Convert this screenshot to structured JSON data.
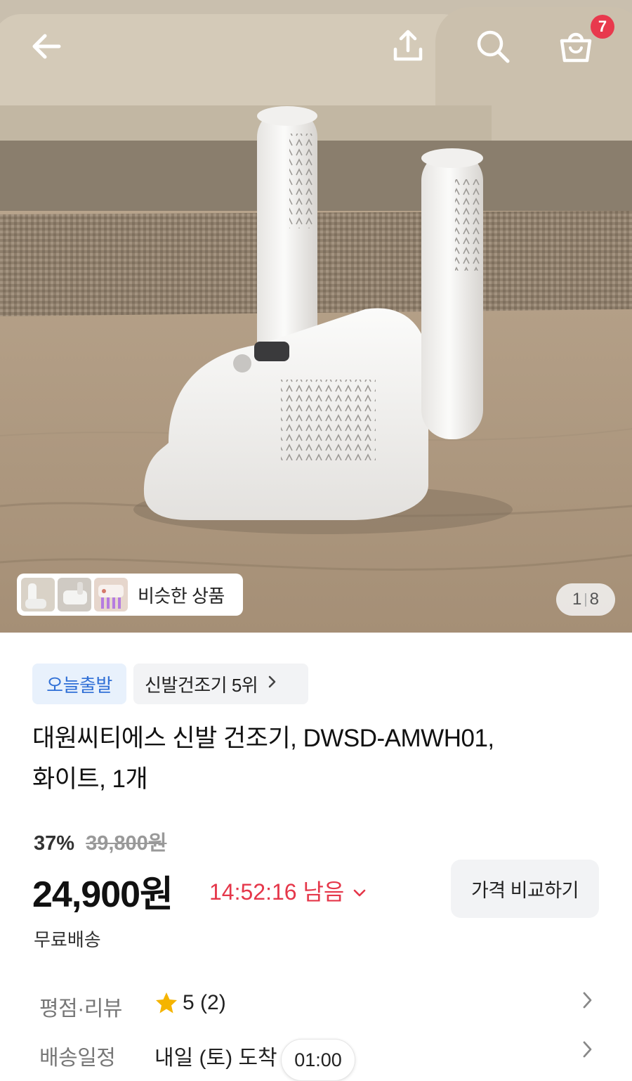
{
  "header": {
    "back_icon": "arrow-left-icon",
    "share_icon": "share-upload-icon",
    "search_icon": "search-icon",
    "cart_icon": "shopping-bag-icon",
    "cart_count": "7"
  },
  "gallery": {
    "similar_label": "비슷한 상품",
    "page_current": "1",
    "page_total": "8"
  },
  "product": {
    "badge_today": "오늘출발",
    "badge_rank": "신발건조기 5위",
    "title_line1": "대원씨티에스 신발 건조기, DWSD-AMWH01,",
    "title_line2": "화이트, 1개",
    "discount": "37%",
    "original_price": "39,800원",
    "price": "24,900원",
    "timer": "14:52:16 남음",
    "compare_label": "가격 비교하기",
    "shipping": "무료배송"
  },
  "details": {
    "rating_label": "평점·리뷰",
    "rating_value": "5 (2)",
    "delivery_label": "배송일정",
    "delivery_value": "내일 (토) 도착",
    "time_pill": "01:00"
  },
  "colors": {
    "accent_red": "#e5374a",
    "accent_blue": "#2f6fd6",
    "star": "#f5b400"
  }
}
